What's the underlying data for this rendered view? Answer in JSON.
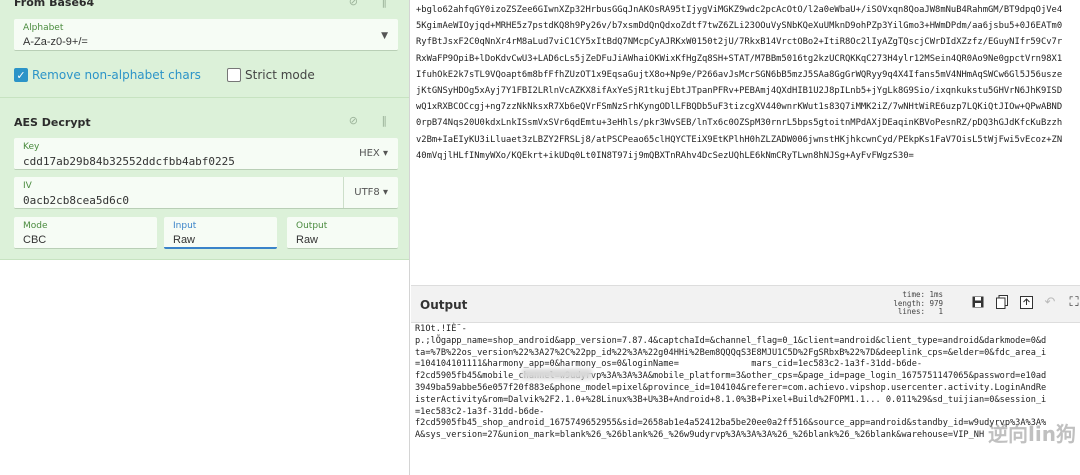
{
  "from_base64": {
    "title": "From Base64",
    "alphabet_label": "Alphabet",
    "alphabet_value": "A-Za-z0-9+/=",
    "remove_label": "Remove non-alphabet chars",
    "strict_label": "Strict mode"
  },
  "aes": {
    "title": "AES Decrypt",
    "key_label": "Key",
    "key_value": "cdd17ab29b84b32552ddcfbb4abf0225",
    "key_enc": "HEX",
    "iv_label": "IV",
    "iv_value": "0acb2cb8cea5d6c0",
    "iv_enc": "UTF8",
    "mode_label": "Mode",
    "mode_value": "CBC",
    "input_label": "Input",
    "input_value": "Raw",
    "output_label": "Output",
    "output_value": "Raw"
  },
  "input_text": "+bglo62ahfqGY0izoZSZee6GIwnXZp32HrbusGGqJnAKOsRA95tIjygViMGKZ9wdc2pcAcOtO/l2a0eWbaU+/iSOVxqn8QoaJW8mNuB4RahmGM/BT9dpqOjVe4\n5KgimAeWIOyjqd+MRHE5z7pstdKQ8h9Py26v/b7xsmDdQnQdxoZdtf7twZ6ZLi23OOuVySNbKQeXuUMknD9ohPZp3YilGmo3+HWmDPdm/aa6jsbu5+0J6EATm0\nRyfBtJsxF2C0qNnXr4rM8aLud7viC1CY5xItBdQ7NMcpCyAJRKxW0150t2jU/7RkxB14VrctOBo2+ItiR8Oc2lIyAZgTQscjCWrDIdXZzfz/EGuyNIfr59Cv7r\nRxWaFP9OpiB+lDoKdvCwU3+LAD6cLs5jZeDFuJiAWhaiOKWixKfHgZq8SH+STAT/M7BBm5016tg2kzUCRQKKqC273H4ylr12MSein4QR0Ao9Ne0gpctVrn98X1\nIfuhOkE2k7sTL9VQoapt6m8bfFfhZUzOT1x9EqsaGujtX8o+Np9e/P266avJsMcrSGN6bB5mzJ5SAa8GgGrWQRyy9q4X4Ifans5mV4NHmAqSWCw6Gl5J56usze\njKtGNSyHDOg5xAyj7Y1FBI2LRlnVcAZKX8ifAxYeSjR1tkujEbtJTpanPFRv+PEBAmj4QXdHIB1U2J8pILnb5+jYgLk8G9Sio/ixqnkukstu5GHVrN6JhK9ISD\nwQ1xRXBCOCcgj+ng7zzNkNksxR7Xb6eQVrFSmNzSrhKyngODlLFBQDb5uF3tizcgXV440wnrKWut1s83Q7iMMK2iZ/7wNHtWiRE6uzp7LQKiQtJIOw+QPwABND\n0rpB74Nqs20U0kdxLnkISsmVxSVr6qdEmtu+3eHhls/pkr3WvSEB/lnTx6c0OZSpM30rnrL5bps5gtoitnMPdAXjDEaqinKBVoPesnRZ/pDQ3hGJdKfcKuBzzh\nv2Bm+IaEIyKU3iLluaet3zLBZY2FRSLj8/atPSCPeao65clHQYCTEiX9EtKPlhH0hZLZADW006jwnstHKjhkcwnCyd/PEkpKs1FaV7OisL5tWjFwi5vEcoz+ZN\n40mVqjlHLfINmyWXo/KQEkrt+ikUDq0Lt0IN8T97ij9mQBXTnRAhv4DcSezUQhLE6kNmCRyTLwn8hNJSg+AyFvFWgzS30=",
  "output_header": {
    "title": "Output",
    "time_label": "time:",
    "time_value": "1ms",
    "length_label": "length:",
    "length_value": "979",
    "lines_label": "lines:",
    "lines_value": "1"
  },
  "output_text": "R1Ot.!IÈ¨-\np.;lÕgapp_name=shop_android&app_version=7.87.4&captchaId=&channel_flag=0_1&client=android&client_type=android&darkmode=0&d\nta=%7B%22os_version%22%3A27%2C%22pp_id%22%3A%22g04HHi%2Bem8QQQqS3E8MJU1C5D%2FgSRbxB%22%7D&deeplink_cps=&elder=0&fdc_area_i\n=104104101111&harmony_app=0&harmony_os=0&loginName=              mars_cid=1ec583c2-1a3f-31dd-b6de-\nf2cd5905fb45&mobile_channel=w9udyrvp%3A%3A%3A&mobile_platform=3&other_cps=&page_id=page_login_1675751147065&password=e10ad\n3949ba59abbe56e057f20f883e&phone_model=pixel&province_id=104104&referer=com.achievo.vipshop.usercenter.activity.LoginAndRe\nisterActivity&rom=Dalvik%2F2.1.0+%28Linux%3B+U%3B+Android+8.1.0%3B+Pixel+Build%2FOPM1.1... 0.011%29&sd_tuijian=0&session_i\n=1ec583c2-1a3f-31dd-b6de-\nf2cd5905fb45_shop_android_1675749652955&sid=2658ab1e4a52412ba5be20ee0a2ff516&source_app=android&standby_id=w9udyrvp%3A%3A%\nA&sys_version=27&union_mark=blank%26_%26blank%26_%26w9udyrvp%3A%3A%3A%26_%26blank%26_%26blank&warehouse=VIP_NH",
  "watermark": "逆向lin狗"
}
